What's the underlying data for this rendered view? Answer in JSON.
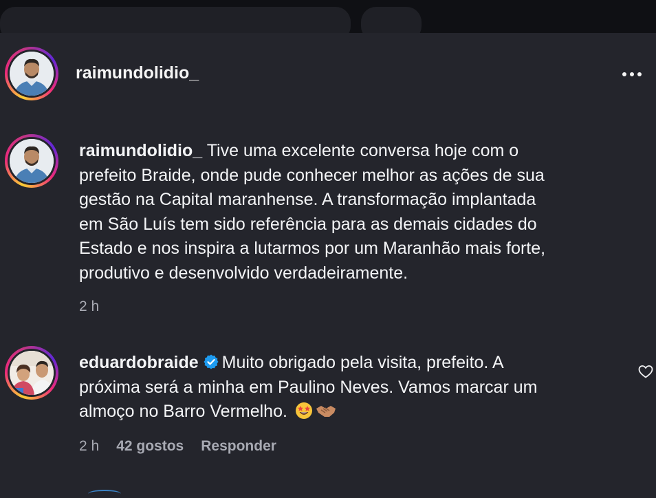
{
  "post": {
    "author": "raimundolidio_",
    "more_label": "Mais opções"
  },
  "caption": {
    "author": "raimundolidio_",
    "lines": [
      "Tive uma excelente conversa hoje com o",
      "prefeito Braide, onde pude conhecer melhor as ações de sua",
      "gestão na Capital maranhense. A transformação implantada",
      "em São Luís tem sido referência para as demais cidades do",
      "Estado e nos inspira a lutarmos por um Maranhão mais forte,",
      "produtivo e desenvolvido verdadeiramente."
    ],
    "time": "2 h"
  },
  "reply": {
    "author": "eduardobraide",
    "verified": true,
    "lines": [
      "Muito obrigado pela visita, prefeito. A",
      "próxima será a minha em Paulino Neves. Vamos marcar um",
      "almoço no Barro Vermelho."
    ],
    "time": "2 h",
    "likes": "42 gostos",
    "reply_label": "Responder"
  },
  "icons": {
    "more": "more-horizontal-icon",
    "verified": "verified-badge-icon",
    "like": "heart-outline-icon",
    "emoji1": "star-struck-emoji",
    "emoji2": "handshake-emoji"
  },
  "colors": {
    "background": "#24252c",
    "text": "#f3f4f6",
    "muted": "#a8aab3",
    "verified": "#1d9bf0"
  }
}
